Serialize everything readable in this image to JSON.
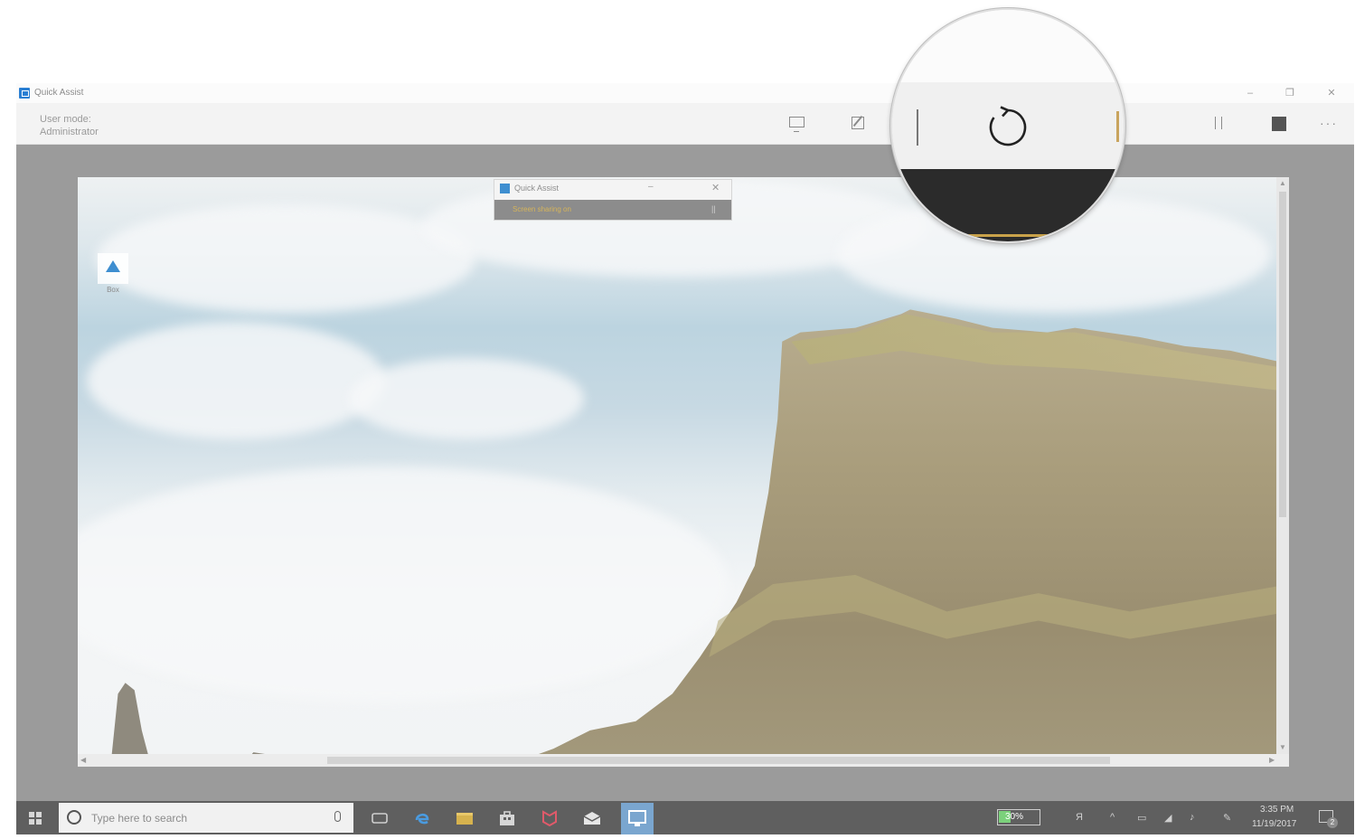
{
  "window": {
    "title": "Quick Assist",
    "minimize": "–",
    "restore": "❐",
    "close": "✕"
  },
  "toolbar": {
    "user_mode_label": "User mode:",
    "user_mode_value": "Administrator",
    "more": "···"
  },
  "remote_desktop": {
    "desktop_icon_label": "Box",
    "mini_window": {
      "title": "Quick Assist",
      "minimize": "–",
      "close": "✕",
      "status": "Screen sharing on",
      "pause": "||"
    }
  },
  "taskbar": {
    "search_placeholder": "Type here to search",
    "battery_percent": "30%",
    "battery_level": 0.3,
    "time": "3:35 PM",
    "date": "11/19/2017",
    "notification_count": "2",
    "tray_icons": [
      "people-icon",
      "chevron-up-icon",
      "tablet-icon",
      "network-icon",
      "volume-icon",
      "pen-icon"
    ]
  },
  "colors": {
    "accent": "#2a7fd3",
    "taskbar": "#5f5f5f",
    "window_bg": "#9b9b9b",
    "status_text": "#d6b45a"
  }
}
